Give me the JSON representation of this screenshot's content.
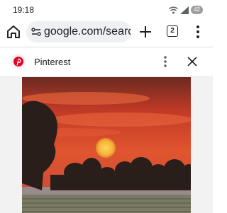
{
  "status_bar": {
    "time": "19:18",
    "battery": "42"
  },
  "browser": {
    "url": "google.com/searc",
    "tab_count": "2",
    "icons": [
      "home-icon",
      "site-settings-icon",
      "plus-icon",
      "tab-switcher-icon",
      "more-vert-icon"
    ]
  },
  "sheet": {
    "title": "Pinterest",
    "icons": [
      "pinterest-logo",
      "more-vert-icon",
      "close-icon"
    ]
  },
  "colors": {
    "pinterest_red": "#e60023",
    "sky_red": "#d9442c",
    "sun": "#f4b43a"
  }
}
